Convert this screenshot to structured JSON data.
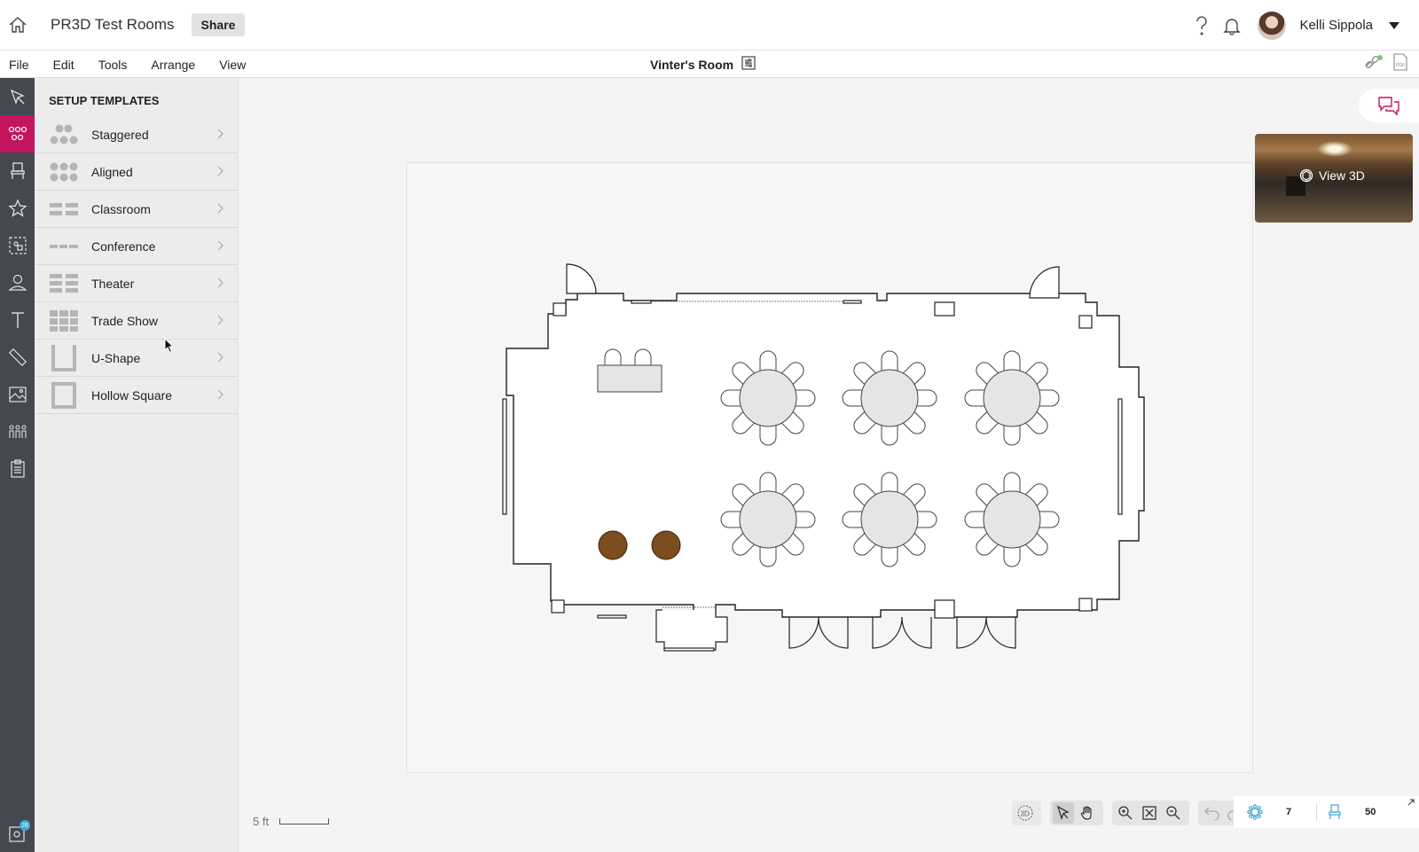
{
  "topbar": {
    "project_title": "PR3D Test Rooms",
    "share_label": "Share",
    "user_name": "Kelli Sippola"
  },
  "menubar": {
    "items": [
      "File",
      "Edit",
      "Tools",
      "Arrange",
      "View"
    ],
    "room_title": "Vinter's Room"
  },
  "panel": {
    "title": "SETUP TEMPLATES",
    "templates": [
      {
        "label": "Staggered",
        "icon": "staggered-icon"
      },
      {
        "label": "Aligned",
        "icon": "aligned-icon"
      },
      {
        "label": "Classroom",
        "icon": "classroom-icon"
      },
      {
        "label": "Conference",
        "icon": "conference-icon"
      },
      {
        "label": "Theater",
        "icon": "theater-icon"
      },
      {
        "label": "Trade Show",
        "icon": "trade-show-icon"
      },
      {
        "label": "U-Shape",
        "icon": "u-shape-icon"
      },
      {
        "label": "Hollow Square",
        "icon": "hollow-square-icon"
      }
    ]
  },
  "canvas": {
    "view3d_label": "View 3D",
    "scale_label": "5 ft"
  },
  "stats": {
    "tables_count": "7",
    "seats_count": "50"
  },
  "rail": {
    "badge": "26"
  },
  "colors": {
    "accent": "#c4155f",
    "rail_bg": "#44494f",
    "panel_bg": "#ececed"
  }
}
